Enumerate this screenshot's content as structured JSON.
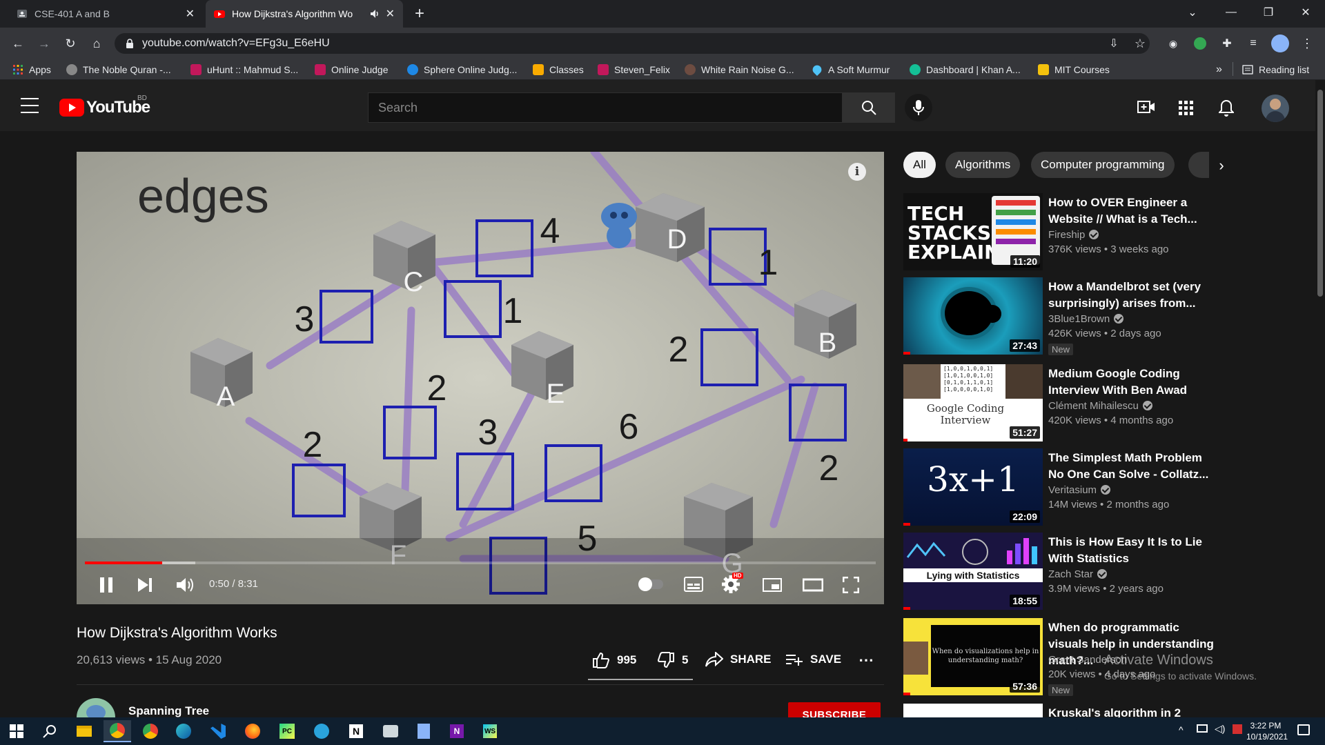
{
  "browser": {
    "tabs": [
      {
        "title": "CSE-401 A and B",
        "active": false
      },
      {
        "title": "How Dijkstra's Algorithm Wo",
        "active": true
      }
    ],
    "url": "youtube.com/watch?v=EFg3u_E6eHU",
    "bookmarks": [
      {
        "label": "Apps",
        "icon": "apps-grid-icon",
        "color": "#ea4335"
      },
      {
        "label": "The Noble Quran -...",
        "icon": "quran-icon",
        "color": "#888888"
      },
      {
        "label": "uHunt :: Mahmud S...",
        "icon": "uva-icon",
        "color": "#c2185b"
      },
      {
        "label": "Online Judge",
        "icon": "uva-icon",
        "color": "#c2185b"
      },
      {
        "label": "Sphere Online Judg...",
        "icon": "spoj-icon",
        "color": "#1e88e5"
      },
      {
        "label": "Classes",
        "icon": "classroom-icon",
        "color": "#f9ab00"
      },
      {
        "label": "Steven_Felix",
        "icon": "uva-icon",
        "color": "#c2185b"
      },
      {
        "label": "White Rain Noise G...",
        "icon": "noise-icon",
        "color": "#6d4c41"
      },
      {
        "label": "A Soft Murmur",
        "icon": "drop-icon",
        "color": "#4fc3f7"
      },
      {
        "label": "Dashboard | Khan A...",
        "icon": "khan-icon",
        "color": "#14bf96"
      },
      {
        "label": "MIT Courses",
        "icon": "folder-icon",
        "color": "#f4c20d"
      }
    ],
    "reading_list": "Reading list",
    "more_chevron": "»"
  },
  "youtube": {
    "logo_text": "YouTube",
    "region": "BD",
    "search_placeholder": "Search"
  },
  "video": {
    "title": "How Dijkstra's Algorithm Works",
    "views": "20,613 views",
    "date": "15 Aug 2020",
    "views_date": "20,613 views • 15 Aug 2020",
    "likes": "995",
    "dislikes": "5",
    "share": "SHARE",
    "save": "SAVE",
    "time": "0:50 / 8:31",
    "progress": 0.098,
    "buffered": 0.14,
    "channel": "Spanning Tree",
    "subscribe": "SUBSCRIBE",
    "hd_badge": "HD",
    "frame": {
      "heading": "edges",
      "nodes": [
        "A",
        "B",
        "C",
        "D",
        "E",
        "F",
        "G"
      ],
      "weights": [
        "3",
        "4",
        "1",
        "1",
        "2",
        "2",
        "2",
        "3",
        "6",
        "2",
        "5"
      ]
    }
  },
  "chips": [
    "All",
    "Algorithms",
    "Computer programming"
  ],
  "recommendations": [
    {
      "title": "How to OVER Engineer a Website // What is a Tech...",
      "channel": "Fireship",
      "meta": "376K views • 3 weeks ago",
      "duration": "11:20",
      "badge": "",
      "thumb_text": "TECH STACKS EXPLAINED",
      "progress": 0
    },
    {
      "title": "How a Mandelbrot set (very surprisingly) arises from...",
      "channel": "3Blue1Brown",
      "meta": "426K views • 2 days ago",
      "duration": "27:43",
      "badge": "New",
      "thumb_text": "",
      "progress": 0.05
    },
    {
      "title": "Medium Google Coding Interview With Ben Awad",
      "channel": "Clément Mihailescu",
      "meta": "420K views • 4 months ago",
      "duration": "51:27",
      "badge": "",
      "thumb_text": "Google Coding Interview",
      "progress": 0.03
    },
    {
      "title": "The Simplest Math Problem No One Can Solve - Collatz...",
      "channel": "Veritasium",
      "meta": "14M views • 2 months ago",
      "duration": "22:09",
      "badge": "",
      "thumb_text": "3x+1",
      "progress": 0.05
    },
    {
      "title": "This is How Easy It Is to Lie With Statistics",
      "channel": "Zach Star",
      "meta": "3.9M views • 2 years ago",
      "duration": "18:55",
      "badge": "",
      "thumb_text": "Lying with Statistics",
      "progress": 0.05
    },
    {
      "title": "When do programmatic visuals help in understanding math?...",
      "channel": "Grant Sanderson",
      "meta": "20K views • 4 days ago",
      "duration": "57:36",
      "badge": "New",
      "thumb_text": "When do visualizations help in understanding math?",
      "progress": 0.05
    },
    {
      "title": "Kruskal's algorithm in 2",
      "channel": "",
      "meta": "",
      "duration": "",
      "badge": "",
      "thumb_text": "",
      "progress": 0
    }
  ],
  "watermark": {
    "line1": "Activate Windows",
    "line2": "Go to Settings to activate Windows."
  },
  "taskbar": {
    "time": "3:22 PM",
    "date": "10/19/2021"
  },
  "colors": {
    "yt_red": "#ff0000",
    "bg": "#181818",
    "accent_blue": "#3ea6ff"
  }
}
